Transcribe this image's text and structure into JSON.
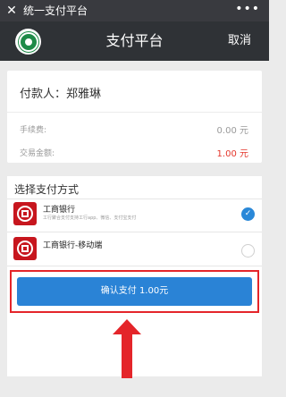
{
  "wechat_bar": {
    "close": "✕",
    "title": "统一支付平台",
    "more": "•••"
  },
  "header": {
    "title": "支付平台",
    "cancel": "取消"
  },
  "payment": {
    "payer": "付款人：郑雅琳",
    "fee_label": "手续费:",
    "fee_value": "0.00 元",
    "amount_label": "交易金额:",
    "amount_value": "1.00 元"
  },
  "methods": {
    "title": "选择支付方式",
    "items": [
      {
        "name": "工商银行",
        "desc": "工行聚合支付支持工行app、微信、支付宝支付",
        "selected": true
      },
      {
        "name": "工商银行-移动端",
        "desc": "",
        "selected": false
      }
    ]
  },
  "confirm_label": "确认支付 1.00元",
  "colors": {
    "accent": "#2a83d6",
    "highlight": "#e4252a",
    "bank": "#c7161e"
  }
}
